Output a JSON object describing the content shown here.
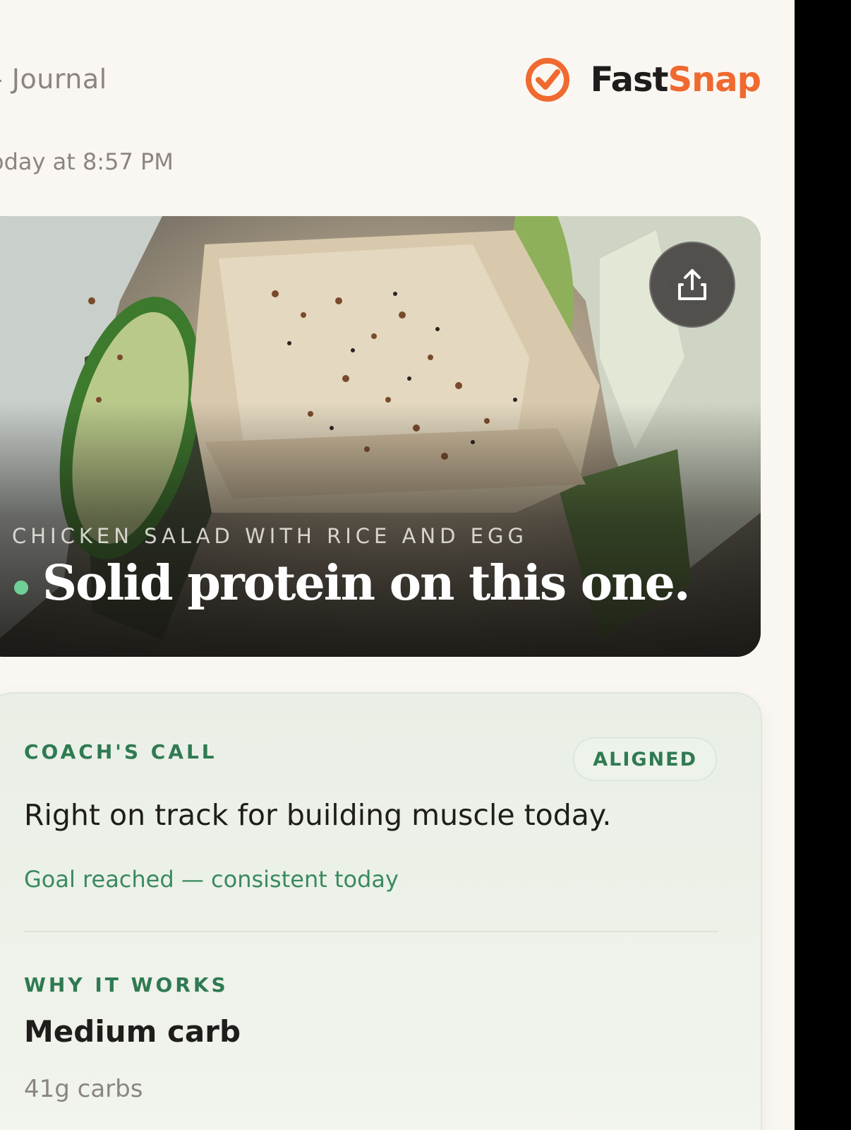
{
  "header": {
    "title": "- Journal",
    "brand": {
      "fast": "Fast",
      "snap": "Snap",
      "accent_color": "#f0692f"
    }
  },
  "entry": {
    "timestamp": "oday at 8:57 PM"
  },
  "hero": {
    "meal_name": "CHICKEN SALAD WITH RICE AND EGG",
    "headline": "Solid protein on this one.",
    "dot_color": "#6fcf97",
    "share_icon": "share-icon"
  },
  "coach": {
    "label": "COACH'S CALL",
    "status": "ALIGNED",
    "message": "Right on track for building muscle today.",
    "goal_note": "Goal reached — consistent today",
    "why_label": "WHY IT WORKS",
    "why_title": "Medium carb",
    "why_detail": "41g carbs",
    "accent_color": "#2f7a52"
  }
}
